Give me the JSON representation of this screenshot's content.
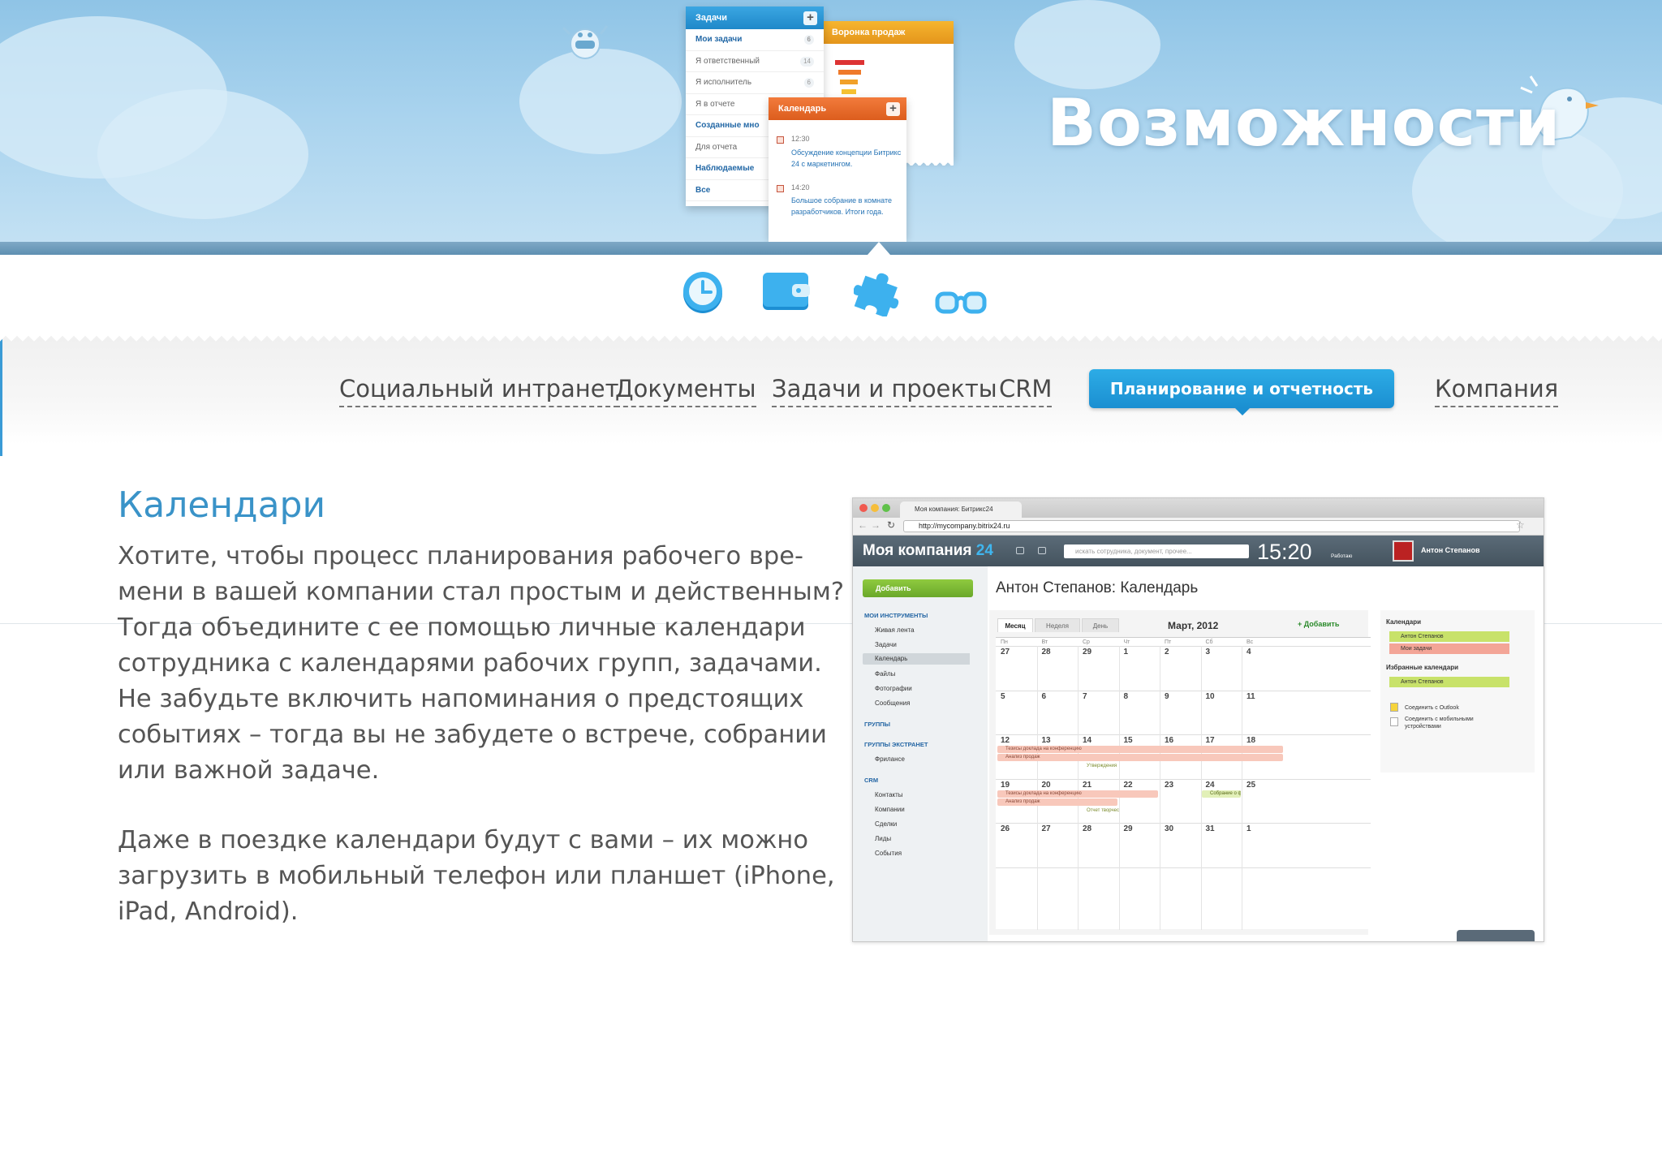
{
  "hero": {
    "title": "Возможности",
    "tasks_card": {
      "title": "Задачи",
      "rows": [
        {
          "label": "Мои задачи",
          "count": "6",
          "bold": true
        },
        {
          "label": "Я ответственный",
          "count": "14",
          "bold": false
        },
        {
          "label": "Я исполнитель",
          "count": "6",
          "bold": false
        },
        {
          "label": "Я в отчете",
          "count": "",
          "bold": false
        },
        {
          "label": "Созданные мно",
          "count": "",
          "bold": true
        },
        {
          "label": "Для отчета",
          "count": "",
          "bold": false
        },
        {
          "label": "Наблюдаемые",
          "count": "",
          "bold": true
        },
        {
          "label": "Все",
          "count": "",
          "bold": true
        }
      ]
    },
    "funnel_card": {
      "title": "Воронка продаж"
    },
    "calendar_card": {
      "title": "Календарь",
      "events": [
        {
          "time": "12:30",
          "text": "Обсуждение концепции Битрикс 24 с маркетингом."
        },
        {
          "time": "14:20",
          "text": "Большое собрание в комнате разработчиков. Итоги года."
        }
      ]
    }
  },
  "feature_icons": [
    "clock-icon",
    "wallet-icon",
    "puzzle-icon",
    "glasses-icon"
  ],
  "nav": {
    "items": [
      "Социальный интранет",
      "Документы",
      "Задачи и проекты",
      "CRM"
    ],
    "active": "Планирование и отчетность",
    "last": "Компания"
  },
  "content": {
    "title": "Календари",
    "para1_lines": [
      "Хотите, чтобы процесс планирования рабочего вре-",
      "мени в вашей компании стал простым и действенным?",
      "Тогда объедините с ее помощью личные календари",
      "сотрудника с календарями рабочих групп, задачами.",
      "Не забудьте включить напоминания о предстоящих",
      "событиях – тогда вы не забудете о встрече, собрании",
      "или важной задаче."
    ],
    "para2_lines": [
      "Даже в поездке календари будут с вами – их можно",
      "загрузить в мобильный телефон или планшет (iPhone,",
      "iPad, Android)."
    ]
  },
  "screenshot": {
    "tab_title": "Моя компания: Битрикс24",
    "url": "http://mycompany.bitrix24.ru",
    "app_name": "Моя компания",
    "app_name_suffix": "24",
    "search_placeholder": "искать сотрудника, документ, прочее...",
    "time": "15:20",
    "status": "Работаю",
    "user": "Антон Степанов",
    "add_button": "Добавить",
    "sidebar": {
      "my_tools": "МОИ ИНСТРУМЕНТЫ",
      "my_tools_items": [
        "Живая лента",
        "Задачи",
        "Календарь",
        "Файлы",
        "Фотографии",
        "Сообщения"
      ],
      "groups": "ГРУППЫ",
      "extranet": "ГРУППЫ ЭКСТРАНЕТ",
      "extranet_items": [
        "Фрилансе"
      ],
      "crm": "CRM",
      "crm_items": [
        "Контакты",
        "Компании",
        "Сделки",
        "Лиды",
        "События"
      ]
    },
    "calendar_title": "Антон Степанов: Календарь",
    "view_tabs": [
      "Месяц",
      "Неделя",
      "День"
    ],
    "month": "Март, 2012",
    "add_link": "Добавить",
    "weekdays": [
      "Пн",
      "Вт",
      "Ср",
      "Чт",
      "Пт",
      "Сб",
      "Вс"
    ],
    "weeks": [
      [
        "27",
        "28",
        "29",
        "1",
        "2",
        "3",
        "4"
      ],
      [
        "5",
        "6",
        "7",
        "8",
        "9",
        "10",
        "11"
      ],
      [
        "12",
        "13",
        "14",
        "15",
        "16",
        "17",
        "18"
      ],
      [
        "19",
        "20",
        "21",
        "22",
        "23",
        "24",
        "25"
      ],
      [
        "26",
        "27",
        "28",
        "29",
        "30",
        "31",
        "1"
      ]
    ],
    "events": {
      "thesis": "Тезисы доклада на конференцию",
      "sales": "Анализ продаж",
      "approval": "Утверждения",
      "report": "Отчет творчес",
      "meeting": "Собрание о ф"
    },
    "right_panel": {
      "calendars_title": "Календари",
      "calendars": [
        "Антон Степанов",
        "Мои задачи"
      ],
      "favorites_title": "Избранные календари",
      "favorites": [
        "Антон Степанов"
      ],
      "outlook": "Соединить с Outlook",
      "mobile": "Соединить с мобильными устройствами"
    }
  }
}
